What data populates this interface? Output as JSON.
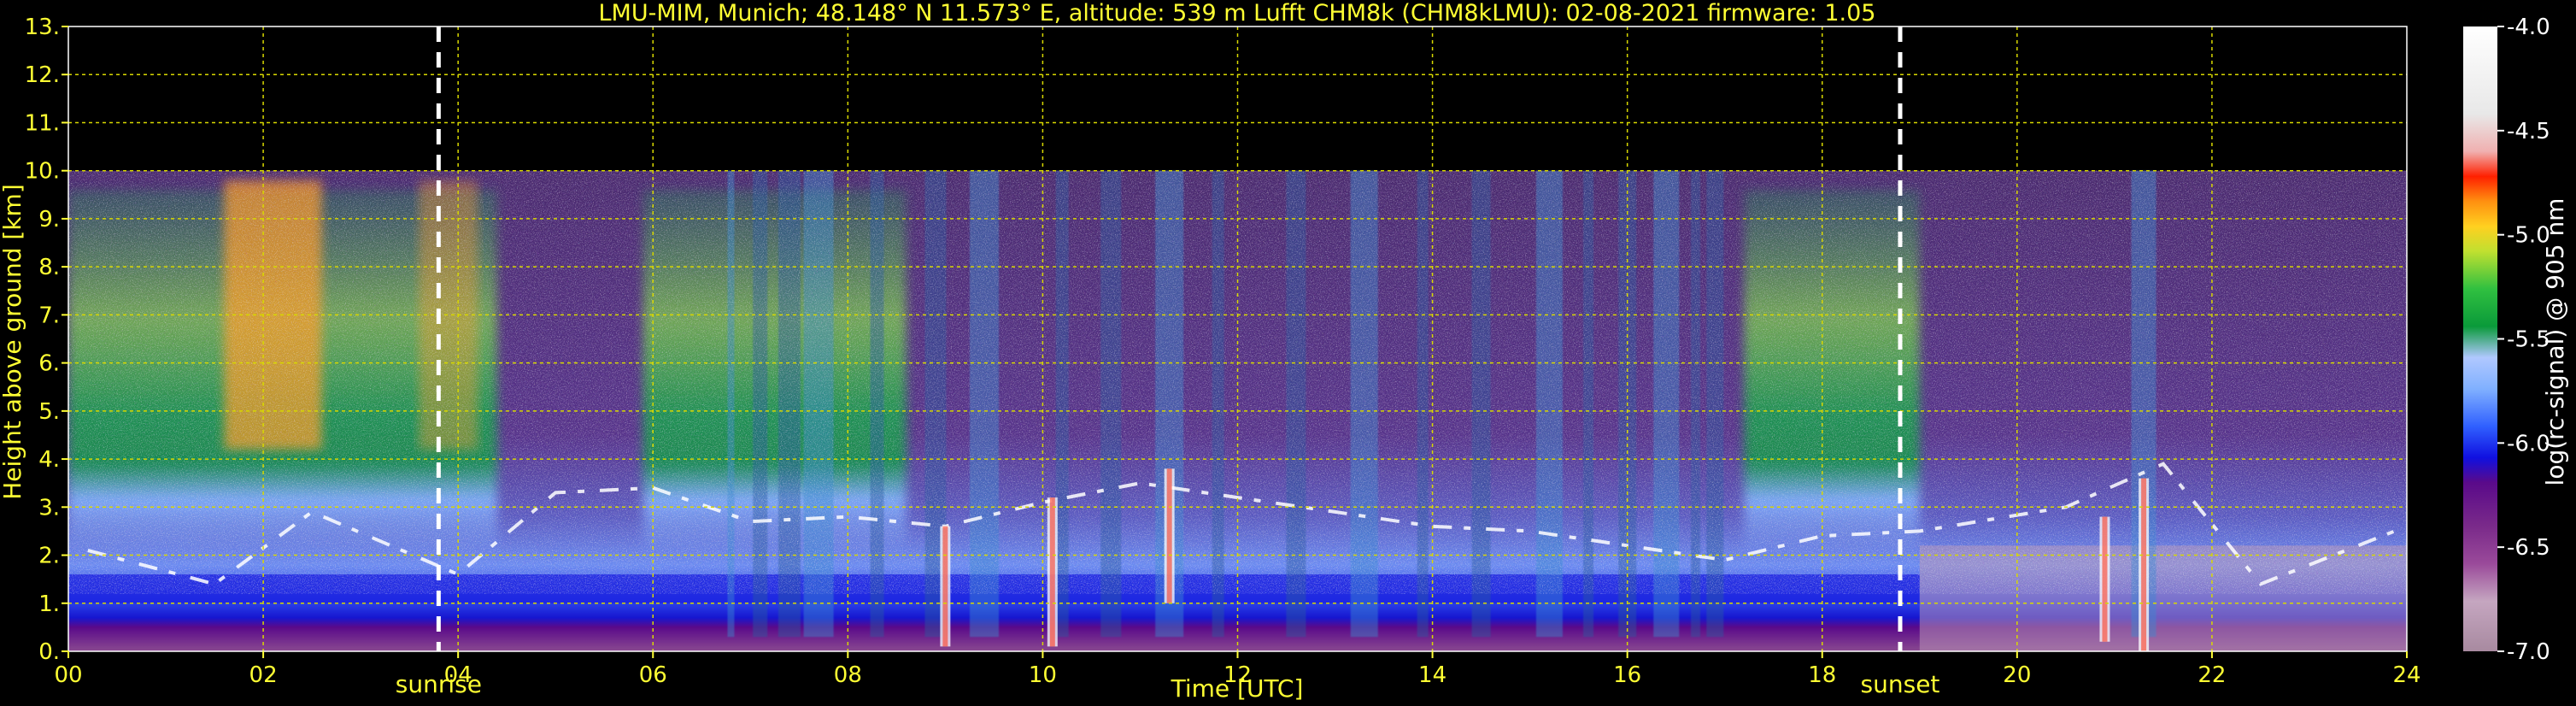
{
  "chart_data": {
    "type": "heatmap",
    "title": "LMU-MIM, Munich; 48.148° N 11.573° E, altitude: 539 m    Lufft CHM8k (CHM8kLMU): 02-08-2021    firmware: 1.05",
    "xlabel": "Time [UTC]",
    "ylabel": "Height above ground [km]",
    "xlim": [
      0,
      24
    ],
    "ylim": [
      0,
      13
    ],
    "x_ticks": [
      "00",
      "02",
      "04",
      "06",
      "08",
      "10",
      "12",
      "14",
      "16",
      "18",
      "20",
      "22",
      "24"
    ],
    "y_ticks": [
      "0.",
      "1.",
      "2.",
      "3.",
      "4.",
      "5.",
      "6.",
      "7.",
      "8.",
      "9.",
      "10.",
      "11.",
      "12.",
      "13."
    ],
    "grid": true,
    "data_top_km": 10.0,
    "events": [
      {
        "label": "sunrise",
        "x": 3.8
      },
      {
        "label": "sunset",
        "x": 18.8
      }
    ],
    "colorbar": {
      "label": "log(rc-signal) @ 905 nm",
      "ticks": [
        "-4.0",
        "-4.5",
        "-5.0",
        "-5.5",
        "-6.0",
        "-6.5",
        "-7.0"
      ],
      "range": [
        -7.0,
        -4.0
      ]
    },
    "features": {
      "boundary_layer_top_km": [
        {
          "x": 0.2,
          "y": 2.1
        },
        {
          "x": 1.5,
          "y": 1.4
        },
        {
          "x": 2.5,
          "y": 2.9
        },
        {
          "x": 4.0,
          "y": 1.6
        },
        {
          "x": 5.0,
          "y": 3.3
        },
        {
          "x": 6.0,
          "y": 3.4
        },
        {
          "x": 7.0,
          "y": 2.7
        },
        {
          "x": 8.0,
          "y": 2.8
        },
        {
          "x": 9.0,
          "y": 2.6
        },
        {
          "x": 10.0,
          "y": 3.1
        },
        {
          "x": 11.0,
          "y": 3.5
        },
        {
          "x": 12.0,
          "y": 3.2
        },
        {
          "x": 13.0,
          "y": 2.9
        },
        {
          "x": 14.0,
          "y": 2.6
        },
        {
          "x": 15.0,
          "y": 2.5
        },
        {
          "x": 16.0,
          "y": 2.2
        },
        {
          "x": 17.0,
          "y": 1.9
        },
        {
          "x": 18.0,
          "y": 2.4
        },
        {
          "x": 19.0,
          "y": 2.5
        },
        {
          "x": 20.5,
          "y": 3.0
        },
        {
          "x": 21.5,
          "y": 3.9
        },
        {
          "x": 22.5,
          "y": 1.4
        },
        {
          "x": 24.0,
          "y": 2.6
        }
      ]
    }
  },
  "colors": {
    "background": "#000000",
    "text": "#ffff33",
    "grid": "#d8d800",
    "event_line": "#ffffff",
    "colormap": [
      "#a88aa0",
      "#c5a6c0",
      "#7a2a8a",
      "#5a0a8a",
      "#1010e0",
      "#5080ff",
      "#80b0ff",
      "#b0c8ff",
      "#0a9a3a",
      "#30c040",
      "#c0e030",
      "#ffd020",
      "#ff9010",
      "#ff2000",
      "#f0b0b0",
      "#e8e8e8",
      "#ffffff"
    ]
  }
}
